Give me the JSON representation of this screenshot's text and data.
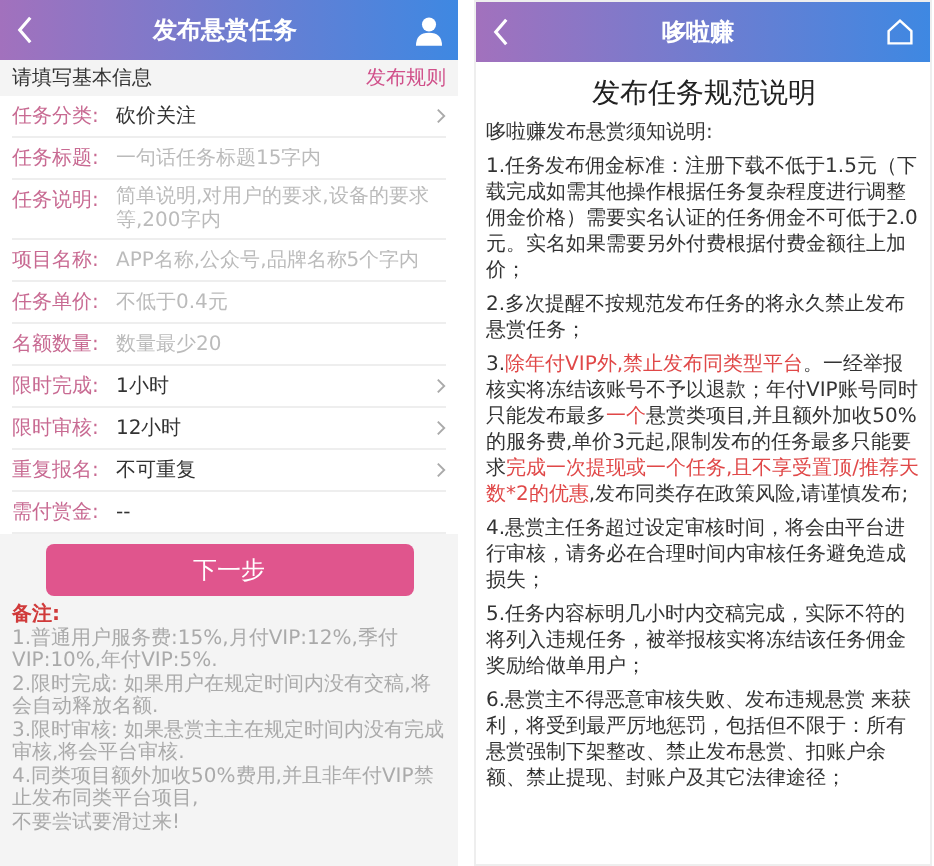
{
  "left": {
    "header": {
      "title": "发布悬赏任务"
    },
    "section": {
      "title": "请填写基本信息",
      "link": "发布规则"
    },
    "fields": [
      {
        "kind": "select",
        "label": "任务分类:",
        "value": "砍价关注"
      },
      {
        "kind": "input",
        "label": "任务标题:",
        "placeholder": "一句话任务标题15字内"
      },
      {
        "kind": "textarea",
        "label": "任务说明:",
        "placeholder": "简单说明,对用户的要求,设备的要求等,200字内"
      },
      {
        "kind": "input",
        "label": "项目名称:",
        "placeholder": "APP名称,公众号,品牌名称5个字内"
      },
      {
        "kind": "input",
        "label": "任务单价:",
        "placeholder": "不低于0.4元"
      },
      {
        "kind": "input",
        "label": "名额数量:",
        "placeholder": "数量最少20"
      },
      {
        "kind": "select",
        "label": "限时完成:",
        "value": "1小时"
      },
      {
        "kind": "select",
        "label": "限时审核:",
        "value": "12小时"
      },
      {
        "kind": "select",
        "label": "重复报名:",
        "value": "不可重复"
      },
      {
        "kind": "display",
        "label": "需付赏金:",
        "value": "--"
      }
    ],
    "button": "下一步",
    "notes": {
      "title": "备注:",
      "lines": [
        "1.普通用户服务费:15%,月付VIP:12%,季付VIP:10%,年付VIP:5%.",
        "2.限时完成: 如果用户在规定时间内没有交稿,将会自动释放名额.",
        "3.限时审核: 如果悬赏主主在规定时间内没有完成审核,将会平台审核.",
        "4.同类项目额外加收50%费用,并且非年付VIP禁止发布同类平台项目,",
        "不要尝试要滑过来!"
      ]
    }
  },
  "right": {
    "header": {
      "title": "哆啦赚"
    },
    "title": "发布任务规范说明",
    "intro": "哆啦赚发布悬赏须知说明:",
    "items": [
      {
        "segments": [
          {
            "text": "1.任务发布佣金标准：注册下载不低于1.5元（下载完成如需其他操作根据任务复杂程度进行调整佣金价格）需要实名认证的任务佣金不可低于2.0元。实名如果需要另外付费根据付费金额往上加价；",
            "highlight": false
          }
        ]
      },
      {
        "segments": [
          {
            "text": "2.多次提醒不按规范发布任务的将永久禁止发布悬赏任务；",
            "highlight": false
          }
        ]
      },
      {
        "segments": [
          {
            "text": "3.",
            "highlight": false
          },
          {
            "text": "除年付VIP外,禁止发布同类型平台",
            "highlight": true
          },
          {
            "text": "。一经举报核实将冻结该账号不予以退款；年付VIP账号同时只能发布最多",
            "highlight": false
          },
          {
            "text": "一个",
            "highlight": true
          },
          {
            "text": "悬赏类项目,并且额外加收50%的服务费,单价3元起,限制发布的任务最多只能要求",
            "highlight": false
          },
          {
            "text": "完成一次提现或一个任务,且不享受置顶/推荐天数*2的优惠",
            "highlight": true
          },
          {
            "text": ",发布同类存在政策风险,请谨慎发布;",
            "highlight": false
          }
        ]
      },
      {
        "segments": [
          {
            "text": "4.悬赏主任务超过设定审核时间，将会由平台进行审核，请务必在合理时间内审核任务避免造成损失；",
            "highlight": false
          }
        ]
      },
      {
        "segments": [
          {
            "text": "5.任务内容标明几小时内交稿完成，实际不符的将列入违规任务，被举报核实将冻结该任务佣金奖励给做单用户；",
            "highlight": false
          }
        ]
      },
      {
        "segments": [
          {
            "text": "6.悬赏主不得恶意审核失败、发布违规悬赏 来获利，将受到最严厉地惩罚，包括但不限于：所有悬赏强制下架整改、禁止发布悬赏、扣账户余额、禁止提现、封账户及其它法律途径；",
            "highlight": false
          }
        ]
      }
    ]
  }
}
